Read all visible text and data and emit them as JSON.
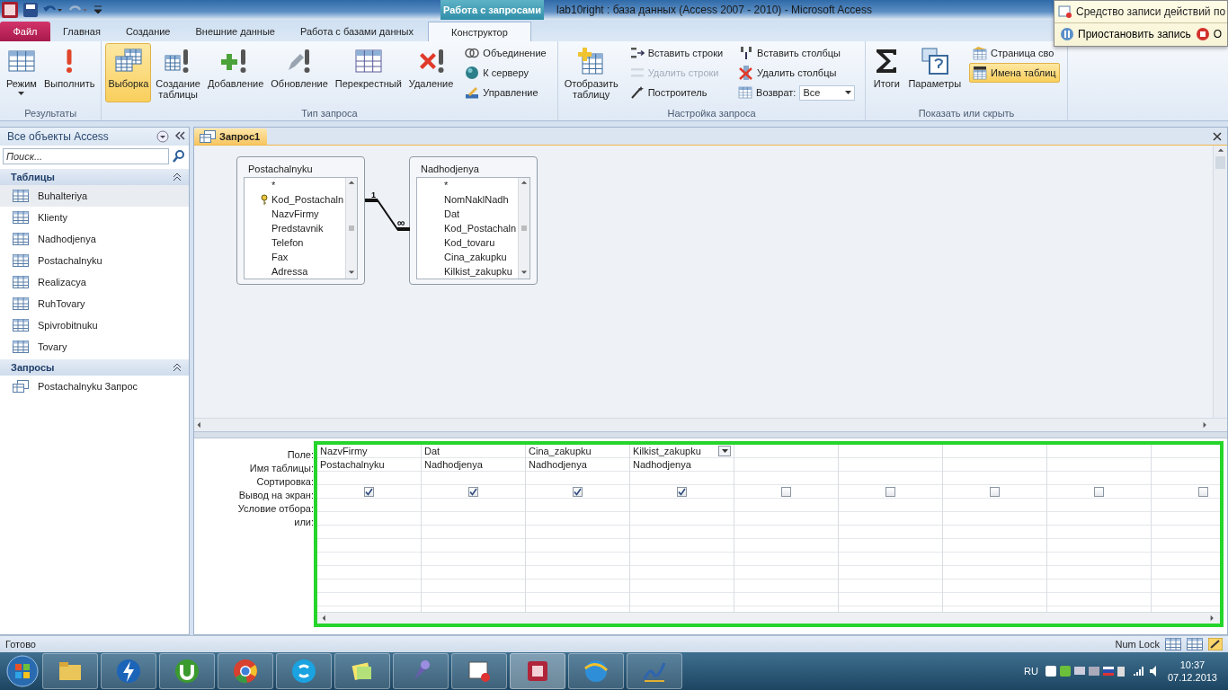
{
  "window": {
    "title": "lab10right : база данных (Access 2007 - 2010)  -  Microsoft Access",
    "context_tab": "Работа с запросами"
  },
  "tabs": [
    {
      "label": "Файл",
      "kind": "file",
      "selected": false
    },
    {
      "label": "Главная",
      "kind": "normal",
      "selected": false
    },
    {
      "label": "Создание",
      "kind": "normal",
      "selected": false
    },
    {
      "label": "Внешние данные",
      "kind": "normal",
      "selected": false
    },
    {
      "label": "Работа с базами данных",
      "kind": "normal",
      "selected": false
    },
    {
      "label": "Конструктор",
      "kind": "context",
      "selected": true
    }
  ],
  "ribbon": [
    {
      "label": "Результаты",
      "buttons": [
        {
          "label": "Режим",
          "kind": "split",
          "selected": false,
          "disabled": false
        },
        {
          "label": "Выполнить",
          "kind": "large",
          "selected": false,
          "disabled": false
        }
      ]
    },
    {
      "label": "Тип запроса",
      "buttons": [
        {
          "label": "Выборка",
          "kind": "large",
          "selected": true,
          "disabled": false
        },
        {
          "label": "Создание таблицы",
          "kind": "large",
          "selected": false,
          "disabled": false
        },
        {
          "label": "Добавление",
          "kind": "large",
          "selected": false,
          "disabled": false
        },
        {
          "label": "Обновление",
          "kind": "large",
          "selected": false,
          "disabled": false
        },
        {
          "label": "Перекрестный",
          "kind": "large",
          "selected": false,
          "disabled": false
        },
        {
          "label": "Удаление",
          "kind": "large",
          "selected": false,
          "disabled": false
        },
        {
          "label": "Объединение",
          "kind": "small",
          "selected": false,
          "disabled": false
        },
        {
          "label": "К серверу",
          "kind": "small",
          "selected": false,
          "disabled": false
        },
        {
          "label": "Управление",
          "kind": "small",
          "selected": false,
          "disabled": false
        }
      ]
    },
    {
      "label": "Настройка запроса",
      "buttons": [
        {
          "label": "Отобразить таблицу",
          "kind": "large",
          "selected": false,
          "disabled": false
        },
        {
          "label": "Вставить строки",
          "kind": "small",
          "selected": false,
          "disabled": false
        },
        {
          "label": "Удалить строки",
          "kind": "small",
          "selected": false,
          "disabled": true
        },
        {
          "label": "Построитель",
          "kind": "small",
          "selected": false,
          "disabled": false
        },
        {
          "label": "Вставить столбцы",
          "kind": "small",
          "selected": false,
          "disabled": false
        },
        {
          "label": "Удалить столбцы",
          "kind": "small",
          "selected": false,
          "disabled": false
        },
        {
          "label": "Возврат:",
          "kind": "combo",
          "value": "Все",
          "selected": false,
          "disabled": false
        }
      ]
    },
    {
      "label": "Показать или скрыть",
      "buttons": [
        {
          "label": "Итоги",
          "kind": "large",
          "selected": false,
          "disabled": false
        },
        {
          "label": "Параметры",
          "kind": "large",
          "selected": false,
          "disabled": false
        },
        {
          "label": "Страница сво",
          "kind": "small",
          "selected": false,
          "disabled": false
        },
        {
          "label": "Имена таблиц",
          "kind": "small",
          "selected": true,
          "disabled": false
        }
      ]
    }
  ],
  "recorder": {
    "title": "Средство записи действий по",
    "buttons": [
      "Приостановить запись",
      "О"
    ]
  },
  "nav": {
    "title": "Все объекты Access",
    "search": {
      "placeholder": "Поиск..."
    },
    "groups": [
      {
        "label": "Таблицы",
        "kind": "table",
        "items": [
          {
            "label": "Buhalteriya",
            "selected": true
          },
          {
            "label": "Klienty",
            "selected": false
          },
          {
            "label": "Nadhodjenya",
            "selected": false
          },
          {
            "label": "Postachalnyku",
            "selected": false
          },
          {
            "label": "Realizacya",
            "selected": false
          },
          {
            "label": "RuhTovary",
            "selected": false
          },
          {
            "label": "Spivrobitnuku",
            "selected": false
          },
          {
            "label": "Tovary",
            "selected": false
          }
        ]
      },
      {
        "label": "Запросы",
        "kind": "query",
        "items": [
          {
            "label": "Postachalnyku Запрос",
            "selected": false
          }
        ]
      }
    ]
  },
  "document": {
    "tab": "Запрос1",
    "tables": [
      {
        "title": "Postachalnyku",
        "fields": [
          {
            "name": "*",
            "key": false
          },
          {
            "name": "Kod_Postachaln",
            "key": true
          },
          {
            "name": "NazvFirmy",
            "key": false
          },
          {
            "name": "Predstavnik",
            "key": false
          },
          {
            "name": "Telefon",
            "key": false
          },
          {
            "name": "Fax",
            "key": false
          },
          {
            "name": "Adressa",
            "key": false
          }
        ]
      },
      {
        "title": "Nadhodjenya",
        "fields": [
          {
            "name": "*",
            "key": false
          },
          {
            "name": "NomNaklNadh",
            "key": false
          },
          {
            "name": "Dat",
            "key": false
          },
          {
            "name": "Kod_Postachaln",
            "key": false
          },
          {
            "name": "Kod_tovaru",
            "key": false
          },
          {
            "name": "Cina_zakupku",
            "key": false
          },
          {
            "name": "Kilkist_zakupku",
            "key": false
          }
        ]
      }
    ],
    "relation": {
      "one": "1",
      "many": "∞"
    }
  },
  "grid": {
    "row_labels": [
      "Поле:",
      "Имя таблицы:",
      "Сортировка:",
      "Вывод на экран:",
      "Условие отбора:",
      "или:"
    ],
    "columns": [
      {
        "field": "NazvFirmy",
        "table": "Postachalnyku",
        "show": true,
        "selected": false
      },
      {
        "field": "Dat",
        "table": "Nadhodjenya",
        "show": true,
        "selected": false
      },
      {
        "field": "Cina_zakupku",
        "table": "Nadhodjenya",
        "show": true,
        "selected": false
      },
      {
        "field": "Kilkist_zakupku",
        "table": "Nadhodjenya",
        "show": true,
        "selected": true
      },
      {
        "show": false,
        "selected": false
      },
      {
        "show": false,
        "selected": false
      },
      {
        "show": false,
        "selected": false
      },
      {
        "show": false,
        "selected": false
      },
      {
        "show": false,
        "selected": false
      }
    ]
  },
  "status": {
    "text": "Готово",
    "indicator": "Num Lock"
  },
  "taskbar": {
    "language": "RU",
    "time": "10:37",
    "date": "07.12.2013"
  }
}
